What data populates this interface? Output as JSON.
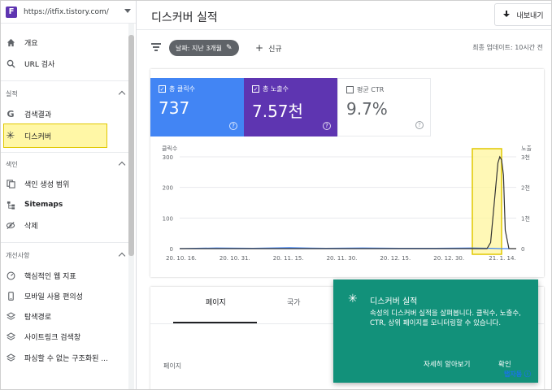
{
  "property": {
    "url": "https://itfix.tistory.com/",
    "favicon_letter": "F"
  },
  "sidebar": {
    "top_items": [
      {
        "label": "개요",
        "icon": "home-icon"
      },
      {
        "label": "URL 검사",
        "icon": "search-icon"
      }
    ],
    "sections": [
      {
        "title": "실적",
        "items": [
          {
            "label": "검색결과",
            "icon": "google-g-icon"
          },
          {
            "label": "디스커버",
            "icon": "asterisk-icon"
          }
        ]
      },
      {
        "title": "색인",
        "items": [
          {
            "label": "색인 생성 범위",
            "icon": "pages-icon"
          },
          {
            "label": "Sitemaps",
            "icon": "sitemap-icon"
          },
          {
            "label": "삭제",
            "icon": "eye-off-icon"
          }
        ]
      },
      {
        "title": "개선사항",
        "items": [
          {
            "label": "핵심적인 웹 지표",
            "icon": "gauge-icon"
          },
          {
            "label": "모바일 사용 편의성",
            "icon": "phone-icon"
          },
          {
            "label": "탐색경로",
            "icon": "layers-icon"
          },
          {
            "label": "사이트링크 검색창",
            "icon": "layers-icon"
          },
          {
            "label": "파싱할 수 없는 구조화된 ...",
            "icon": "layers-icon"
          }
        ]
      }
    ]
  },
  "header": {
    "title": "디스커버 실적",
    "export_label": "내보내기"
  },
  "filter": {
    "date_chip": "날짜: 지난 3개월",
    "new_label": "신규",
    "updated": "최종 업데이트: 10시간 전"
  },
  "metrics": [
    {
      "label": "총 클릭수",
      "value": "737",
      "checked": true,
      "color": "#4285f4"
    },
    {
      "label": "총 노출수",
      "value": "7.57천",
      "checked": true,
      "color": "#5e35b1"
    },
    {
      "label": "평균 CTR",
      "value": "9.7%",
      "checked": false
    }
  ],
  "chart_data": {
    "type": "line",
    "ylabel_left": "클릭수",
    "ylabel_right": "노출",
    "yticks_left": [
      "300",
      "200",
      "100",
      "0"
    ],
    "yticks_right": [
      "3천",
      "2천",
      "1천",
      "0"
    ],
    "ylim_left": [
      0,
      300
    ],
    "ylim_right": [
      0,
      3000
    ],
    "x_ticks": [
      "20. 10. 16.",
      "20. 10. 31.",
      "20. 11. 15.",
      "20. 11. 30.",
      "20. 12. 15.",
      "20. 12. 30.",
      "21. 1. 14."
    ],
    "series": [
      {
        "name": "클릭수",
        "color": "#4285f4",
        "axis": "left",
        "points": [
          [
            0,
            0
          ],
          [
            10,
            2
          ],
          [
            20,
            1
          ],
          [
            30,
            3
          ],
          [
            40,
            1
          ],
          [
            50,
            2
          ],
          [
            60,
            1
          ],
          [
            70,
            1
          ],
          [
            80,
            2
          ],
          [
            85,
            1
          ],
          [
            88,
            0
          ],
          [
            89,
            0
          ],
          [
            90,
            0
          ]
        ]
      },
      {
        "name": "노출",
        "color": "#5e35b1",
        "axis": "right",
        "points": [
          [
            0,
            0
          ],
          [
            80,
            0
          ],
          [
            84,
            0
          ],
          [
            85,
            200
          ],
          [
            86,
            1500
          ],
          [
            87,
            2800
          ],
          [
            87.5,
            3000
          ],
          [
            88,
            2900
          ],
          [
            88.5,
            2400
          ],
          [
            89,
            600
          ],
          [
            90,
            0
          ],
          [
            92,
            0
          ]
        ]
      }
    ]
  },
  "tabs": [
    "페이지",
    "국가"
  ],
  "table": {
    "col_head": "페이지"
  },
  "toast": {
    "title": "디스커버 실적",
    "body": "속성의 디스커버 실적을 살펴봅니다. 클릭수, 노출수, CTR, 상위 페이지를 모니터링할 수 있습니다.",
    "learn_more": "자세히 알아보기",
    "confirm": "확인"
  },
  "watermark": "탭자동 ⓘ"
}
